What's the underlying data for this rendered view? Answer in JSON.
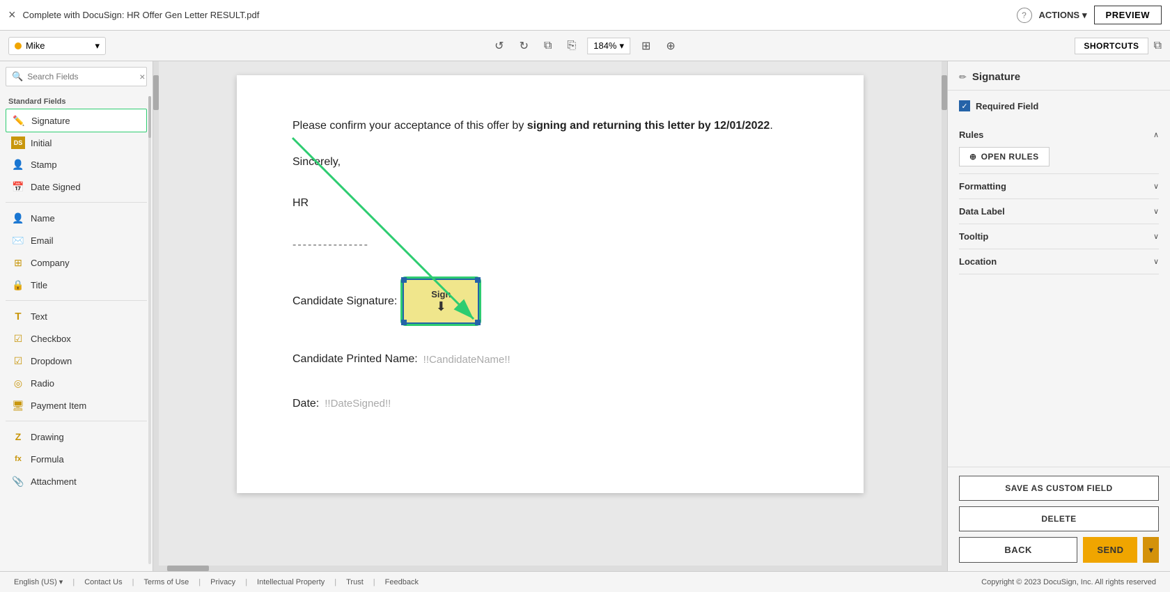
{
  "topbar": {
    "close_icon": "×",
    "doc_title": "Complete with DocuSign: HR Offer Gen Letter RESULT.pdf",
    "help_icon": "?",
    "actions_label": "ACTIONS",
    "actions_chevron": "▾",
    "preview_label": "PREVIEW"
  },
  "toolbar2": {
    "recipient_name": "Mike",
    "recipient_dot_color": "#f0a500",
    "undo_icon": "↺",
    "redo_icon": "↻",
    "copy_icon": "⧉",
    "paste_icon": "⎘",
    "zoom_level": "184%",
    "zoom_chevron": "▾",
    "multi_icon": "⊞",
    "tag_icon": "⊕",
    "shortcuts_label": "SHORTCUTS",
    "copy2_icon": "⧉"
  },
  "sidebar": {
    "search_placeholder": "Search Fields",
    "standard_label": "Standard Fields",
    "fields": [
      {
        "label": "Signature",
        "icon": "✏️",
        "type": "signature",
        "active": true
      },
      {
        "label": "Initial",
        "icon": "DS",
        "type": "initial",
        "active": false
      },
      {
        "label": "Stamp",
        "icon": "👤",
        "type": "stamp",
        "active": false
      },
      {
        "label": "Date Signed",
        "icon": "📅",
        "type": "date",
        "active": false
      }
    ],
    "fields2": [
      {
        "label": "Name",
        "icon": "👤",
        "type": "name"
      },
      {
        "label": "Email",
        "icon": "✉️",
        "type": "email"
      },
      {
        "label": "Company",
        "icon": "⊞",
        "type": "company"
      },
      {
        "label": "Title",
        "icon": "🔒",
        "type": "title"
      }
    ],
    "fields3": [
      {
        "label": "Text",
        "icon": "T",
        "type": "text"
      },
      {
        "label": "Checkbox",
        "icon": "☑",
        "type": "checkbox"
      },
      {
        "label": "Dropdown",
        "icon": "☑",
        "type": "dropdown"
      },
      {
        "label": "Radio",
        "icon": "◎",
        "type": "radio"
      },
      {
        "label": "Payment Item",
        "icon": "🖥",
        "type": "payment"
      }
    ],
    "fields4": [
      {
        "label": "Drawing",
        "icon": "Z",
        "type": "drawing"
      },
      {
        "label": "Formula",
        "icon": "fx",
        "type": "formula"
      },
      {
        "label": "Attachment",
        "icon": "📎",
        "type": "attachment"
      }
    ]
  },
  "document": {
    "para1": "Please confirm your acceptance of this offer by ",
    "para1_bold": "signing and returning this letter by 12/01/2022",
    "para1_end": ".",
    "sincerely": "Sincerely,",
    "from": "HR",
    "dashes": "---------------",
    "candidate_signature_label": "Candidate Signature:",
    "candidate_name_label": "Candidate Printed Name:",
    "candidate_name_placeholder": "!!CandidateName!!",
    "date_label": "Date:",
    "date_placeholder": "!!DateSigned!!",
    "sign_label": "Sign",
    "sign_icon": "⬇"
  },
  "rightpanel": {
    "header_icon": "✏",
    "header_title": "Signature",
    "required_label": "Required Field",
    "rules_label": "Rules",
    "open_rules_label": "OPEN RULES",
    "open_rules_icon": "⊕",
    "formatting_label": "Formatting",
    "data_label_label": "Data Label",
    "tooltip_label": "Tooltip",
    "location_label": "Location",
    "save_custom_label": "SAVE AS CUSTOM FIELD",
    "delete_label": "DELETE",
    "back_label": "BACK",
    "send_label": "SEND",
    "send_chevron": "▾"
  },
  "footer": {
    "language": "English (US) ▾",
    "contact": "Contact Us",
    "terms": "Terms of Use",
    "privacy": "Privacy",
    "intellectual": "Intellectual Property",
    "trust": "Trust",
    "feedback": "Feedback",
    "copyright": "Copyright © 2023 DocuSign, Inc. All rights reserved"
  }
}
